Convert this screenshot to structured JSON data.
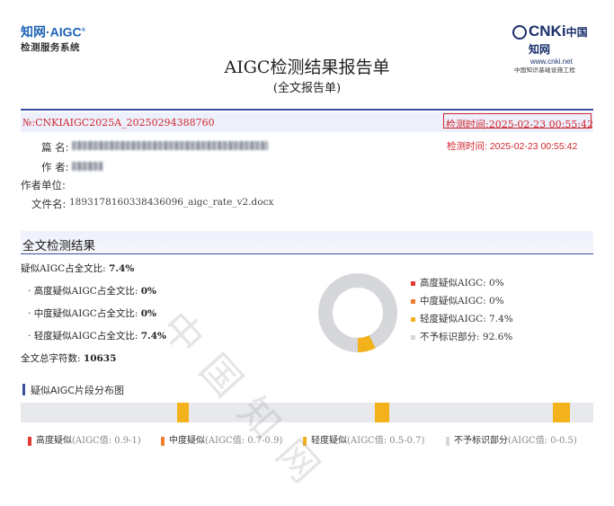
{
  "header": {
    "logo_left_line1": "知网·AIGC",
    "logo_left_sup": "®",
    "logo_left_line2": "检测服务系统",
    "logo_right_mark": "CNKi",
    "logo_right_cn": "中国知网",
    "logo_right_url": "www.cnki.net",
    "logo_right_tagline": "中国知识基础设施工程"
  },
  "report": {
    "title": "AIGC检测结果报告单",
    "subtitle": "(全文报告单)",
    "number": "№:CNKIAIGC2025A_20250294388760",
    "time_boxed": "检测时间:2025-02-23 00:55:42",
    "time_plain": "检测时间: 2025-02-23 00:55:42"
  },
  "meta": {
    "title_label": "篇 名:",
    "author_label": "作 者:",
    "unit_label": "作者单位:",
    "file_label": "文件名:",
    "file_value": "1893178160338436096_aigc_rate_v2.docx"
  },
  "results": {
    "section_title": "全文检测结果",
    "overall_label": "疑似AIGC占全文比:",
    "overall_value": "7.4%",
    "items": [
      {
        "label": "高度疑似AIGC占全文比:",
        "value": "0%"
      },
      {
        "label": "中度疑似AIGC占全文比:",
        "value": "0%"
      },
      {
        "label": "轻度疑似AIGC占全文比:",
        "value": "7.4%"
      }
    ],
    "chars_label": "全文总字符数:",
    "chars_value": "10635"
  },
  "legend": [
    {
      "label": "高度疑似AIGC:",
      "value": "0%",
      "color": "#e53935"
    },
    {
      "label": "中度疑似AIGC:",
      "value": "0%",
      "color": "#ef7f2f"
    },
    {
      "label": "轻度疑似AIGC:",
      "value": "7.4%",
      "color": "#f3b21b"
    },
    {
      "label": "不予标识部分:",
      "value": "92.6%",
      "color": "#d5d7da"
    }
  ],
  "donut": {
    "light_fraction": 0.074
  },
  "distribution": {
    "title": "疑似AIGC片段分布图",
    "segments": [
      {
        "start": 0.273,
        "width": 0.021
      },
      {
        "start": 0.619,
        "width": 0.024
      },
      {
        "start": 0.929,
        "width": 0.03
      }
    ]
  },
  "bottom_legend": [
    {
      "name": "高度疑似",
      "range": "(AIGC值: 0.9-1)",
      "color": "#e53935"
    },
    {
      "name": "中度疑似",
      "range": "(AIGC值: 0.7-0.9)",
      "color": "#ef7f2f"
    },
    {
      "name": "轻度疑似",
      "range": "(AIGC值: 0.5-0.7)",
      "color": "#f3b21b"
    },
    {
      "name": "不予标识部分",
      "range": "(AIGC值: 0-0.5)",
      "color": "#d5d7da"
    }
  ],
  "watermark": "中国知网"
}
